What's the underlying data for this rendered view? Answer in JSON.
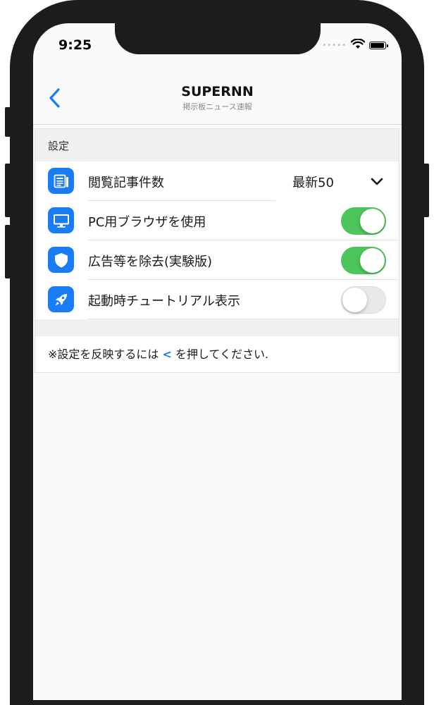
{
  "status_bar": {
    "time": "9:25",
    "signal": "•••••"
  },
  "navbar": {
    "title": "SUPERNN",
    "subtitle": "掲示板ニュース速報"
  },
  "settings": {
    "section_title": "設定",
    "rows": [
      {
        "label": "閲覧記事件数",
        "value": "最新50",
        "icon": "newspaper-icon",
        "control": "dropdown"
      },
      {
        "label": "PC用ブラウザを使用",
        "icon": "desktop-icon",
        "control": "toggle",
        "on": true
      },
      {
        "label": "広告等を除去(実験版)",
        "icon": "shield-icon",
        "control": "toggle",
        "on": true
      },
      {
        "label": "起動時チュートリアル表示",
        "icon": "rocket-icon",
        "control": "toggle",
        "on": false
      }
    ],
    "note_before": "※設定を反映するには",
    "note_chevron": "<",
    "note_after": "を押してください."
  },
  "colors": {
    "accent": "#1a7cf5",
    "toggle_on": "#4cc55a",
    "toggle_off": "#e9e9ea"
  }
}
